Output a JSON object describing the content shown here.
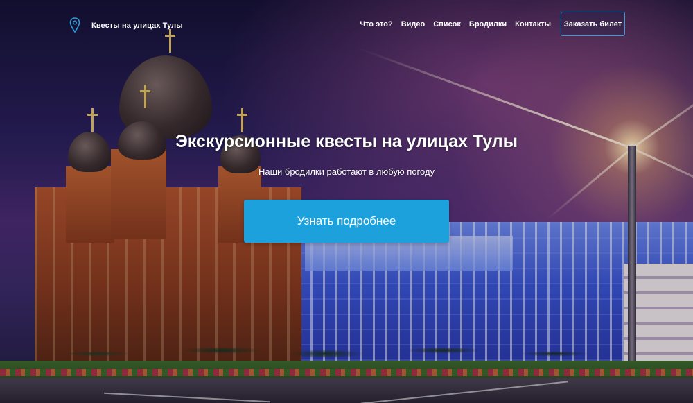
{
  "brand": {
    "title": "Квесты на улицах Тулы",
    "icon": "map-pin-icon"
  },
  "nav": {
    "items": [
      {
        "label": "Что это?"
      },
      {
        "label": "Видео"
      },
      {
        "label": "Список"
      },
      {
        "label": "Бродилки"
      },
      {
        "label": "Контакты"
      }
    ],
    "ticket_button": "Заказать билет"
  },
  "hero": {
    "title": "Экскурсионные квесты на улицах Тулы",
    "subtitle": "Наши бродилки работают в любую погоду",
    "cta_label": "Узнать подробнее"
  },
  "colors": {
    "accent": "#1da1dc",
    "button_border": "#2ba0dc"
  }
}
